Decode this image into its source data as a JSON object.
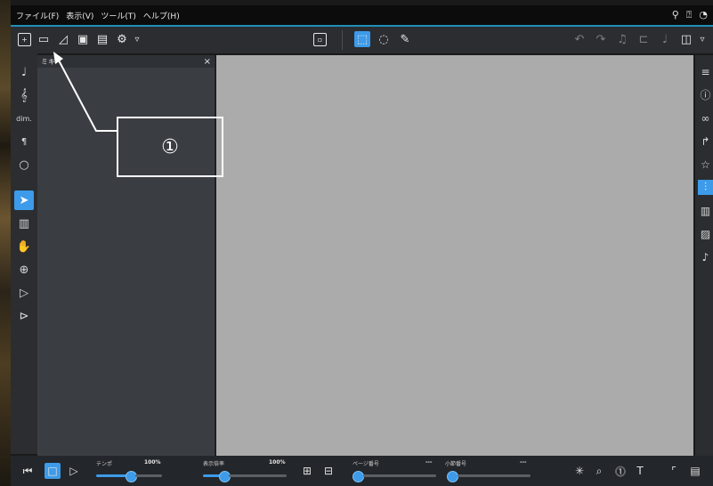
{
  "menubar": {
    "items": [
      "ファイル(F)",
      "表示(V)",
      "ツール(T)",
      "ヘルプ(H)"
    ],
    "right_icons": [
      "book-icon",
      "help-icon",
      "extra-icon"
    ]
  },
  "side_panel": {
    "tab_label": "ミキ",
    "close_label": "×"
  },
  "annotation": {
    "label": "①"
  },
  "bottombar": {
    "tempo_label": "テンポ",
    "tempo_value": "100%",
    "zoom_label": "表示倍率",
    "zoom_value": "100%",
    "page_label": "ページ番号",
    "page_value": "---",
    "measure_label": "小節番号",
    "measure_value": "---"
  },
  "colors": {
    "accent": "#3d9be9",
    "menubar_underline": "#1f8fb8",
    "canvas": "#ababab"
  }
}
